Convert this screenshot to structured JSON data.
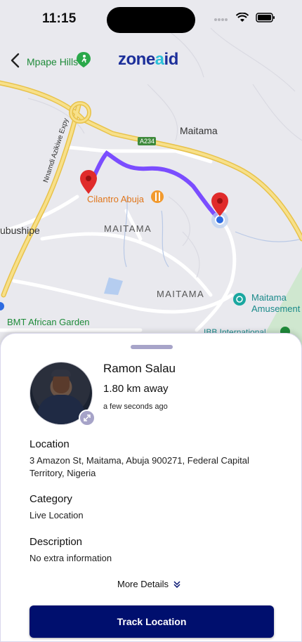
{
  "status_bar": {
    "time": "11:15"
  },
  "header": {
    "back_label": "Mpape Hills",
    "logo_main": "zone",
    "logo_accent": "a",
    "logo_tail": "id"
  },
  "map": {
    "labels": {
      "maitama_top": "Maitama",
      "road_a234": "A234",
      "expressway": "Nnamdi Azikiwe Expy",
      "cilantro": "Cilantro Abuja",
      "maitama_area1": "MAITAMA",
      "maitama_area2": "MAITAMA",
      "bushipe": "ubushipe",
      "maitama_amusement_1": "Maitama",
      "maitama_amusement_2": "Amusement",
      "bmt": "BMT African Garden",
      "ibb": "IBB International"
    },
    "route_color": "#7b4dff",
    "pin_color": "#e02b2b"
  },
  "sheet": {
    "name": "Ramon Salau",
    "distance": "1.80 km away",
    "updated": "a few seconds ago",
    "location_title": "Location",
    "location_value": "3 Amazon St, Maitama, Abuja 900271, Federal Capital Territory, Nigeria",
    "category_title": "Category",
    "category_value": "Live Location",
    "description_title": "Description",
    "description_value": "No extra information",
    "more_details": "More Details",
    "track_button": "Track Location"
  },
  "colors": {
    "primary": "#000f6e",
    "accent": "#a7a4c9"
  },
  "icons": [
    "back-icon",
    "hiking-icon",
    "restaurant-icon",
    "amusement-park-icon",
    "expand-icon",
    "chevron-double-down-icon",
    "wifi-icon",
    "signal-icon",
    "battery-icon"
  ]
}
